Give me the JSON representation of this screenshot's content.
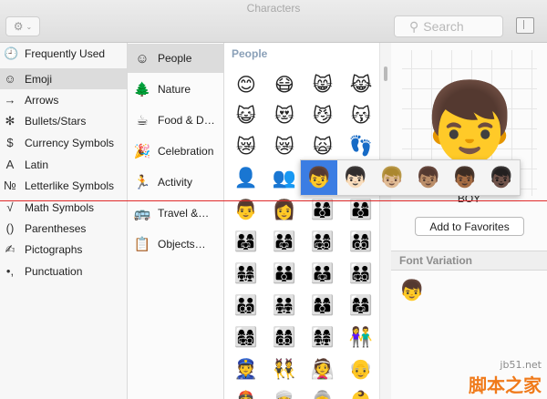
{
  "window": {
    "title": "Characters"
  },
  "toolbar": {
    "gear_icon": "⚙",
    "search_placeholder": "Search"
  },
  "sidebar": {
    "items": [
      {
        "label": "Frequently Used",
        "icon": "🕘"
      },
      {
        "label": "Emoji",
        "icon": "☺"
      },
      {
        "label": "Arrows",
        "icon": "→"
      },
      {
        "label": "Bullets/Stars",
        "icon": "✻"
      },
      {
        "label": "Currency Symbols",
        "icon": "$"
      },
      {
        "label": "Latin",
        "icon": "A"
      },
      {
        "label": "Letterlike Symbols",
        "icon": "№"
      },
      {
        "label": "Math Symbols",
        "icon": "√"
      },
      {
        "label": "Parentheses",
        "icon": "()"
      },
      {
        "label": "Pictographs",
        "icon": "✍"
      },
      {
        "label": "Punctuation",
        "icon": "•,"
      }
    ]
  },
  "categories": {
    "items": [
      {
        "label": "People",
        "icon": "☺"
      },
      {
        "label": "Nature",
        "icon": "🌲"
      },
      {
        "label": "Food & D…",
        "icon": "☕"
      },
      {
        "label": "Celebration",
        "icon": "🎉"
      },
      {
        "label": "Activity",
        "icon": "🏃"
      },
      {
        "label": "Travel &…",
        "icon": "🚌"
      },
      {
        "label": "Objects…",
        "icon": "📋"
      }
    ]
  },
  "grid": {
    "header": "People",
    "rows": [
      [
        "😊",
        "😷",
        "😸",
        "😹"
      ],
      [
        "😺",
        "😻",
        "😼",
        "😽"
      ],
      [
        "😿",
        "😿",
        "🙀",
        "👣"
      ],
      [
        "👤",
        "👥",
        "👦",
        "👦"
      ],
      [
        "👨",
        "👩",
        "👨‍👩‍👦",
        "👨‍👩‍👦"
      ],
      [
        "👨‍👩‍👧",
        "👨‍👩‍👧",
        "👨‍👩‍👧‍👦",
        "👨‍👩‍👦‍👦"
      ],
      [
        "👨‍👩‍👧‍👧",
        "👨‍👨‍👦",
        "👨‍👨‍👧",
        "👨‍👨‍👧‍👦"
      ],
      [
        "👨‍👨‍👦‍👦",
        "👨‍👨‍👧‍👧",
        "👩‍👩‍👦",
        "👩‍👩‍👧"
      ],
      [
        "👩‍👩‍👧‍👦",
        "👩‍👩‍👦‍👦",
        "👩‍👩‍👧‍👧",
        "👫"
      ],
      [
        "👮",
        "👯",
        "👰",
        "👴"
      ],
      [
        "👲",
        "👳",
        "👵",
        "👶"
      ]
    ]
  },
  "skin_tones": [
    "👦",
    "👦🏻",
    "👦🏼",
    "👦🏽",
    "👦🏾",
    "👦🏿"
  ],
  "detail": {
    "preview": "👦",
    "name": "BOY",
    "favorites_button": "Add to Favorites",
    "font_variation_header": "Font Variation",
    "font_variation_glyph": "👦"
  },
  "watermark": {
    "chinese": "脚本之家",
    "url": "jb51.net"
  }
}
